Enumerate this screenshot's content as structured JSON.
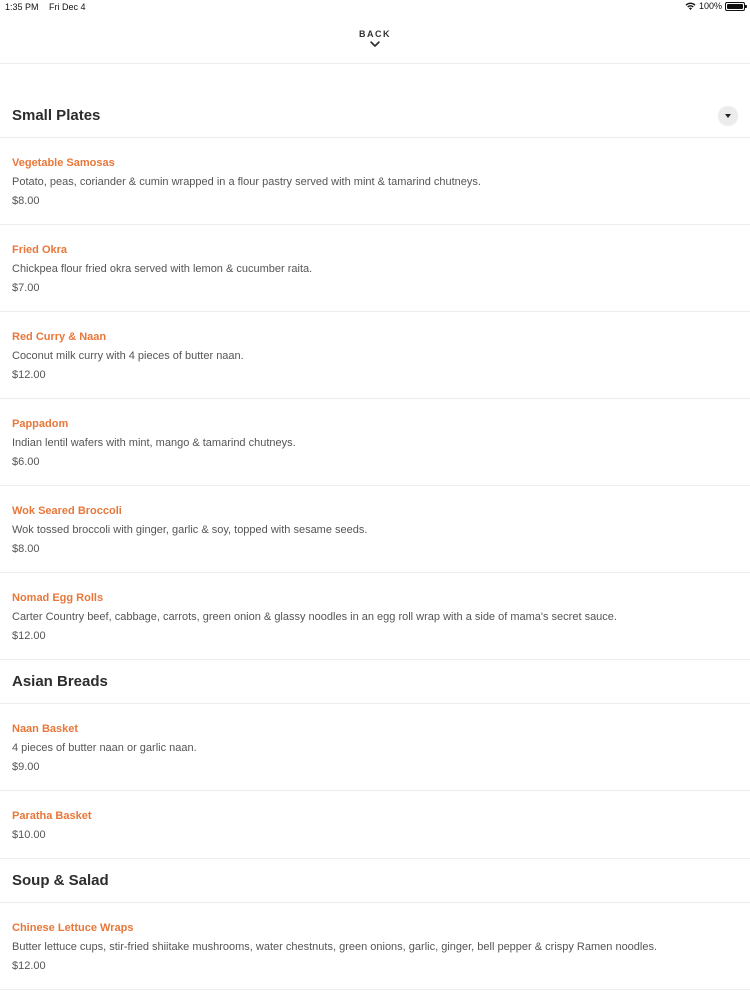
{
  "status": {
    "time": "1:35 PM",
    "date": "Fri Dec 4",
    "battery": "100%"
  },
  "nav": {
    "back_label": "BACK"
  },
  "accent_color": "#e8773a",
  "sections": [
    {
      "title": "Small Plates",
      "items": [
        {
          "name": "Vegetable Samosas",
          "description": "Potato, peas, coriander & cumin wrapped in a flour pastry served with mint & tamarind chutneys.",
          "price": "$8.00"
        },
        {
          "name": "Fried Okra",
          "description": "Chickpea flour fried okra served with lemon & cucumber raita.",
          "price": "$7.00"
        },
        {
          "name": "Red Curry & Naan",
          "description": "Coconut milk curry with 4 pieces of butter naan.",
          "price": "$12.00"
        },
        {
          "name": "Pappadom",
          "description": "Indian lentil wafers with mint, mango & tamarind chutneys.",
          "price": "$6.00"
        },
        {
          "name": "Wok Seared Broccoli",
          "description": "Wok tossed broccoli with ginger, garlic & soy, topped with sesame seeds.",
          "price": "$8.00"
        },
        {
          "name": "Nomad Egg Rolls",
          "description": "Carter Country beef, cabbage, carrots, green onion & glassy noodles in an egg roll wrap with a side of mama's secret sauce.",
          "price": "$12.00"
        }
      ]
    },
    {
      "title": "Asian Breads",
      "items": [
        {
          "name": "Naan Basket",
          "description": "4 pieces of butter naan or garlic naan.",
          "price": "$9.00"
        },
        {
          "name": "Paratha Basket",
          "description": "",
          "price": "$10.00"
        }
      ]
    },
    {
      "title": "Soup & Salad",
      "items": [
        {
          "name": "Chinese Lettuce Wraps",
          "description": "Butter lettuce cups, stir-fried shiitake mushrooms, water chestnuts, green onions, garlic, ginger, bell pepper & crispy Ramen noodles.",
          "price": "$12.00"
        }
      ]
    }
  ]
}
